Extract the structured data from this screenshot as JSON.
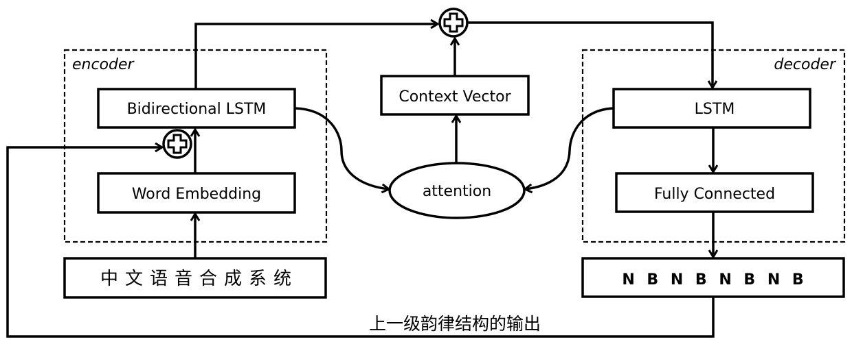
{
  "diagram": {
    "encoder": {
      "label": "encoder",
      "bilstm": "Bidirectional LSTM",
      "embedding": "Word Embedding"
    },
    "decoder": {
      "label": "decoder",
      "lstm": "LSTM",
      "fc": "Fully Connected"
    },
    "context_vector": "Context Vector",
    "attention": "attention",
    "input_text": "中文语音合成系统",
    "output_text": "N B N B N B N B",
    "feedback_label": "上一级韵律结构的输出",
    "icons": {
      "sum_top": "circled-plus-icon",
      "sum_encoder": "circled-plus-icon"
    },
    "colors": {
      "stroke": "#000000",
      "background": "#ffffff"
    }
  }
}
